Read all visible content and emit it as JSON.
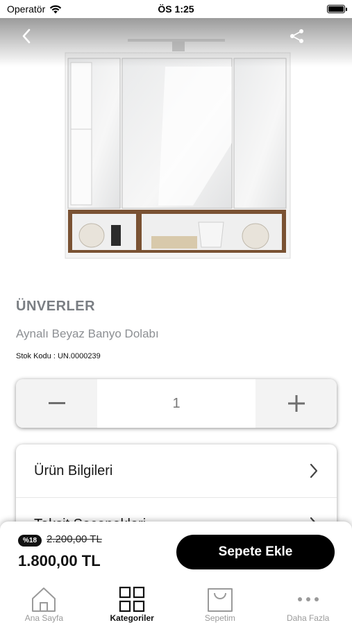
{
  "status_bar": {
    "carrier": "Operatör",
    "time": "ÖS 1:25"
  },
  "header": {
    "back_icon": "chevron-left-icon",
    "share_icon": "share-icon"
  },
  "product": {
    "image": "mirror-cabinet-illustration",
    "brand": "ÜNVERLER",
    "name": "Aynalı Beyaz Banyo Dolabı",
    "stock_label": "Stok Kodu :",
    "stock_code": "UN.0000239"
  },
  "quantity": {
    "value": "1",
    "minus_icon": "minus-icon",
    "plus_icon": "plus-icon"
  },
  "info_sections": [
    {
      "label": "Ürün Bilgileri"
    },
    {
      "label": "Taksit Seçenekleri"
    }
  ],
  "price": {
    "discount_badge": "%18",
    "old_price": "2.200,00 TL",
    "new_price": "1.800,00 TL",
    "cart_button": "Sepete Ekle"
  },
  "tabs": [
    {
      "label": "Ana Sayfa",
      "icon": "home-icon",
      "active": false
    },
    {
      "label": "Kategoriler",
      "icon": "grid-icon",
      "active": true
    },
    {
      "label": "Sepetim",
      "icon": "shopping-bag-icon",
      "active": false
    },
    {
      "label": "Daha Fazla",
      "icon": "more-icon",
      "active": false
    }
  ],
  "colors": {
    "brand_text": "#7a7e83",
    "cart_button_bg": "#000000",
    "active_tab": "#111111",
    "inactive_tab": "#9a9a9a"
  }
}
